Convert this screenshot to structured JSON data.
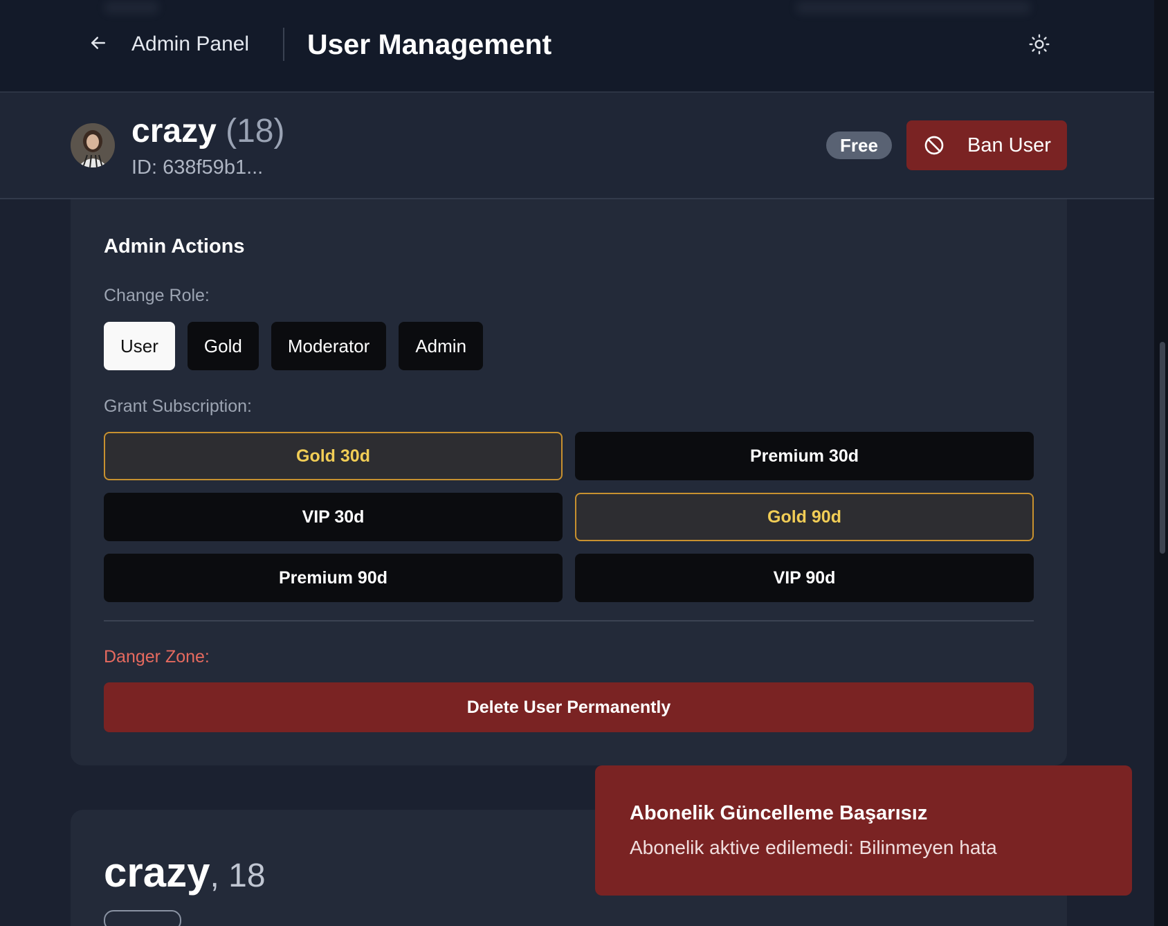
{
  "header": {
    "back_label": "Admin Panel",
    "title": "User Management",
    "back_icon": "arrow-left-icon",
    "theme_icon": "sun-icon"
  },
  "user": {
    "name": "crazy",
    "age": "(18)",
    "id": "ID: 638f59b1...",
    "plan": "Free",
    "ban_label": "Ban User",
    "ban_icon": "ban-icon"
  },
  "admin_actions": {
    "title": "Admin Actions",
    "change_role_label": "Change Role:",
    "roles": [
      {
        "label": "User",
        "active": true
      },
      {
        "label": "Gold",
        "active": false
      },
      {
        "label": "Moderator",
        "active": false
      },
      {
        "label": "Admin",
        "active": false
      }
    ],
    "grant_label": "Grant Subscription:",
    "subscriptions": [
      {
        "label": "Gold 30d",
        "highlight": true
      },
      {
        "label": "Premium 30d",
        "highlight": false
      },
      {
        "label": "VIP 30d",
        "highlight": false
      },
      {
        "label": "Gold 90d",
        "highlight": true
      },
      {
        "label": "Premium 90d",
        "highlight": false
      },
      {
        "label": "VIP 90d",
        "highlight": false
      }
    ],
    "danger_label": "Danger Zone:",
    "delete_label": "Delete User Permanently"
  },
  "profile": {
    "name": "crazy",
    "age": ", 18"
  },
  "toast": {
    "title": "Abonelik Güncelleme Başarısız",
    "description": "Abonelik aktive edilemedi: Bilinmeyen hata"
  },
  "colors": {
    "danger": "#7a2323",
    "gold_border": "#c8912f",
    "gold_text": "#f1cd56"
  }
}
